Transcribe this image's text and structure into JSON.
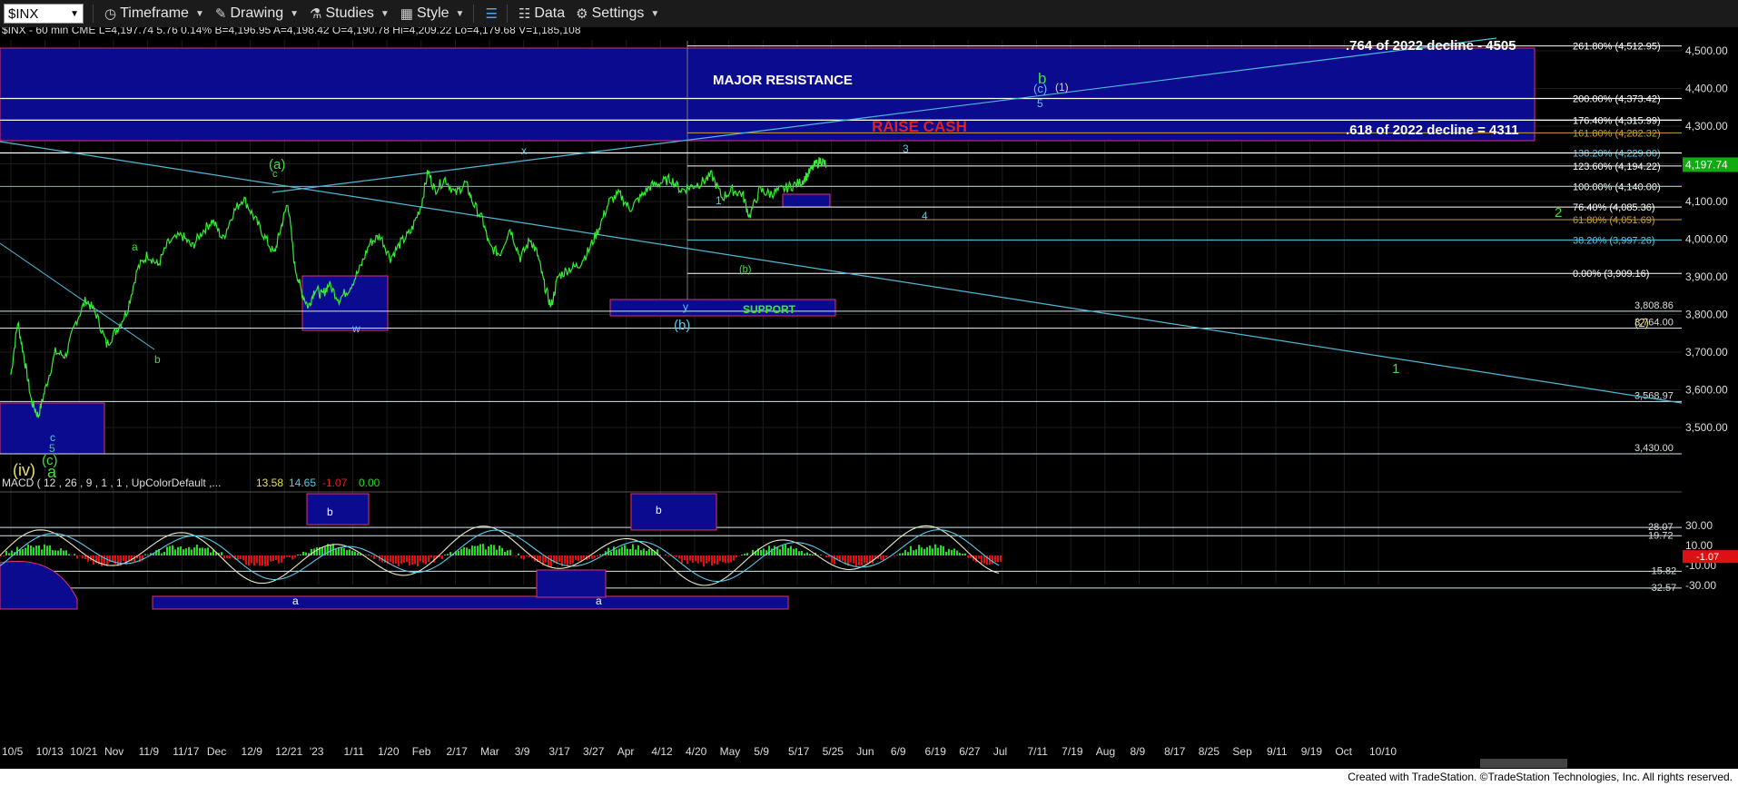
{
  "toolbar": {
    "symbol": "$INX",
    "items": [
      {
        "label": "Timeframe",
        "icon": "clock-icon"
      },
      {
        "label": "Drawing",
        "icon": "pencil-icon"
      },
      {
        "label": "Studies",
        "icon": "flask-icon"
      },
      {
        "label": "Style",
        "icon": "style-icon"
      },
      {
        "label": "",
        "icon": "layout-icon"
      },
      {
        "label": "Data",
        "icon": "bar-chart-icon"
      },
      {
        "label": "Settings",
        "icon": "gear-icon"
      }
    ]
  },
  "header": "$INX - 60 min  CME  L=4,197.74  5.76  0.14%  B=4,196.95  A=4,198.42  O=4,190.78  Hi=4,209.22  Lo=4,179.68  V=1,185,108",
  "macd_header": {
    "label": "MACD ( 12 , 26 , 9 , 1 , 1 , UpColorDefault ,...",
    "v1": "13.58",
    "v2": "14.65",
    "v3": "-1.07",
    "v4": "0.00"
  },
  "footer": "Created with TradeStation. ©TradeStation Technologies, Inc. All rights reserved.",
  "colors": {
    "price": "#33ee33",
    "trendline": "#4fb8d8",
    "box_fill": "#0b0b8f",
    "box_edge": "#e0306a",
    "fib_white": "#ffffff",
    "fib_gold": "#c8a038",
    "label_green": "#44dd44",
    "label_yellow": "#e8e060",
    "label_cyan": "#5ac8e8",
    "resistance_red": "#dd2222",
    "macd_pos": "#22dd22",
    "macd_neg": "#dd1111",
    "macd_line": "#e8e8c0",
    "signal_line": "#5ac8e8"
  },
  "chart_data": {
    "type": "line",
    "title": "$INX - 60 min",
    "x_ticks": [
      "10/5",
      "10/13",
      "10/21",
      "Nov",
      "11/9",
      "11/17",
      "Dec",
      "12/9",
      "12/21",
      "'23",
      "1/11",
      "1/20",
      "Feb",
      "2/17",
      "Mar",
      "3/9",
      "3/17",
      "3/27",
      "Apr",
      "4/12",
      "4/20",
      "May",
      "5/9",
      "5/17",
      "5/25",
      "Jun",
      "6/9",
      "6/19",
      "6/27",
      "Jul",
      "7/11",
      "7/19",
      "Aug",
      "8/9",
      "8/17",
      "8/25",
      "Sep",
      "9/11",
      "9/19",
      "Oct",
      "10/10"
    ],
    "y_ticks": [
      3500,
      3600,
      3700,
      3800,
      3900,
      4000,
      4100,
      4200,
      4300,
      4400,
      4500
    ],
    "y_tick_labels": [
      "3,500.00",
      "3,600.00",
      "3,700.00",
      "3,800.00",
      "3,900.00",
      "4,000.00",
      "4,100.00",
      "4,200.00",
      "4,300.00",
      "4,400.00",
      "4,500.00"
    ],
    "ylim": [
      3430,
      4520
    ],
    "series": [
      {
        "values": [
          [
            0,
            3640
          ],
          [
            0.2,
            3780
          ],
          [
            0.4,
            3680
          ],
          [
            0.6,
            3570
          ],
          [
            0.8,
            3530
          ],
          [
            1,
            3600
          ],
          [
            1.3,
            3700
          ],
          [
            1.6,
            3690
          ],
          [
            1.9,
            3780
          ],
          [
            2.2,
            3840
          ],
          [
            2.5,
            3800
          ],
          [
            2.8,
            3720
          ],
          [
            3.1,
            3760
          ],
          [
            3.4,
            3810
          ],
          [
            3.7,
            3920
          ],
          [
            4,
            3960
          ],
          [
            4.3,
            3930
          ],
          [
            4.6,
            3990
          ],
          [
            5,
            4010
          ],
          [
            5.3,
            3980
          ],
          [
            5.6,
            4020
          ],
          [
            5.9,
            4050
          ],
          [
            6.2,
            4000
          ],
          [
            6.5,
            4070
          ],
          [
            6.8,
            4110
          ],
          [
            7.1,
            4060
          ],
          [
            7.4,
            4010
          ],
          [
            7.7,
            3960
          ],
          [
            7.9,
            4030
          ],
          [
            8.1,
            4100
          ],
          [
            8.3,
            3930
          ],
          [
            8.5,
            3860
          ],
          [
            8.7,
            3820
          ],
          [
            8.9,
            3870
          ],
          [
            9.1,
            3850
          ],
          [
            9.3,
            3880
          ],
          [
            9.6,
            3840
          ],
          [
            9.9,
            3870
          ],
          [
            10.2,
            3920
          ],
          [
            10.5,
            3990
          ],
          [
            10.8,
            4010
          ],
          [
            11.1,
            3950
          ],
          [
            11.4,
            3990
          ],
          [
            11.7,
            4020
          ],
          [
            12,
            4090
          ],
          [
            12.2,
            4180
          ],
          [
            12.4,
            4130
          ],
          [
            12.7,
            4160
          ],
          [
            13,
            4120
          ],
          [
            13.3,
            4150
          ],
          [
            13.5,
            4100
          ],
          [
            13.8,
            4050
          ],
          [
            14,
            3980
          ],
          [
            14.3,
            3960
          ],
          [
            14.6,
            4030
          ],
          [
            14.9,
            3950
          ],
          [
            15.2,
            4000
          ],
          [
            15.4,
            3960
          ],
          [
            15.6,
            3880
          ],
          [
            15.8,
            3820
          ],
          [
            16,
            3900
          ],
          [
            16.3,
            3920
          ],
          [
            16.6,
            3930
          ],
          [
            16.9,
            3970
          ],
          [
            17.2,
            4030
          ],
          [
            17.5,
            4100
          ],
          [
            17.8,
            4120
          ],
          [
            18.1,
            4080
          ],
          [
            18.4,
            4110
          ],
          [
            18.7,
            4140
          ],
          [
            19,
            4150
          ],
          [
            19.3,
            4160
          ],
          [
            19.6,
            4130
          ],
          [
            19.9,
            4140
          ],
          [
            20.2,
            4150
          ],
          [
            20.5,
            4170
          ],
          [
            20.8,
            4110
          ],
          [
            21.1,
            4130
          ],
          [
            21.4,
            4120
          ],
          [
            21.6,
            4060
          ],
          [
            21.9,
            4130
          ],
          [
            22.2,
            4120
          ],
          [
            22.5,
            4130
          ],
          [
            22.8,
            4140
          ],
          [
            23.1,
            4150
          ],
          [
            23.3,
            4170
          ],
          [
            23.5,
            4195
          ],
          [
            23.7,
            4210
          ],
          [
            23.85,
            4195
          ]
        ]
      }
    ],
    "fib_levels": [
      {
        "value": 4512.95,
        "label": "261.80% (4,512.95)",
        "color": "#ffffff"
      },
      {
        "value": 4373.42,
        "label": "200.00% (4,373.42)",
        "color": "#ffffff"
      },
      {
        "value": 4315.99,
        "label": "176.40% (4,315.99)",
        "color": "#ffffff"
      },
      {
        "value": 4282.32,
        "label": "161.80% (4,282.32)",
        "color": "#c8a038"
      },
      {
        "value": 4229.0,
        "label": "138.20% (4,229.00)",
        "color": "#5ac8e8"
      },
      {
        "value": 4194.22,
        "label": "123.60% (4,194.22)",
        "color": "#ffffff"
      },
      {
        "value": 4140.0,
        "label": "100.00% (4,140.00)",
        "color": "#ffffff"
      },
      {
        "value": 4085.36,
        "label": "76.40% (4,085.36)",
        "color": "#ffffff"
      },
      {
        "value": 4051.69,
        "label": "61.80% (4,051.69)",
        "color": "#c8a038"
      },
      {
        "value": 3997.26,
        "label": "38.20% (3,997.26)",
        "color": "#5ac8e8"
      },
      {
        "value": 3909.16,
        "label": "0.00% (3,909.16)",
        "color": "#ffffff"
      }
    ],
    "levels": [
      {
        "value": 3808.86,
        "label": "3,808.86"
      },
      {
        "value": 3764.0,
        "label": "3,764.00"
      },
      {
        "value": 3568.97,
        "label": "3,568.97"
      },
      {
        "value": 3430.0,
        "label": "3,430.00"
      }
    ],
    "last_price": "4,197.74",
    "annotations": {
      "major_resistance": "MAJOR RESISTANCE",
      "raise_cash": "RAISE CASH",
      "support": "SUPPORT",
      "fib_764": ".764 of 2022 decline - 4505",
      "fib_618": ".618 of 2022 decline = 4311",
      "wave_labels": [
        "(iv)",
        "(c)",
        "a",
        "5",
        "c",
        "a",
        "b",
        "(a)",
        "c",
        "w",
        "x",
        "y",
        "(b)",
        "(b)",
        "1",
        "3",
        "4",
        "5",
        "b",
        "(c)",
        "(1)",
        "(2)",
        "1",
        "2"
      ]
    },
    "macd": {
      "y_ticks": [
        "30.00",
        "10.00",
        "-10.00",
        "-30.00"
      ],
      "levels": [
        "28.07",
        "19.72",
        "-15.82",
        "-32.57"
      ],
      "current": "-1.07",
      "labels": [
        "b",
        "b",
        "a",
        "a"
      ]
    }
  }
}
